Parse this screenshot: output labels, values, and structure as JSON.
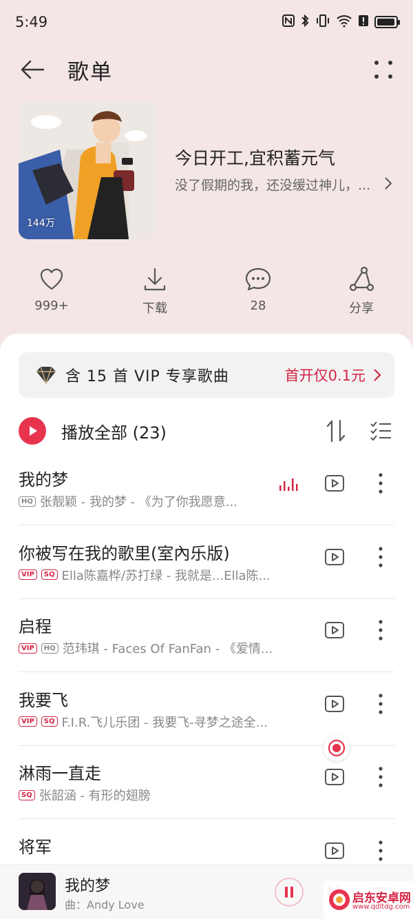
{
  "status_bar": {
    "time": "5:49"
  },
  "header": {
    "title": "歌单"
  },
  "playlist": {
    "cover_play_count": "144万",
    "title": "今日开工,宜积蓄元气",
    "description": "没了假期的我，还没缓过神儿，..."
  },
  "actions": [
    {
      "icon": "heart-icon",
      "label": "999+"
    },
    {
      "icon": "download-icon",
      "label": "下载"
    },
    {
      "icon": "comment-icon",
      "label": "28"
    },
    {
      "icon": "share-icon",
      "label": "分享"
    }
  ],
  "vip_banner": {
    "text": "含 15 首 VIP 专享歌曲",
    "offer": "首开仅0.1元"
  },
  "play_all": {
    "label": "播放全部 (23)"
  },
  "songs": [
    {
      "title": "我的梦",
      "badges": [
        "HQ"
      ],
      "artist": "张靓颖 - 我的梦 - 《为了你我愿意...",
      "playing": true
    },
    {
      "title": "你被写在我的歌里(室內乐版)",
      "badges": [
        "VIP",
        "SQ"
      ],
      "artist": "Ella陈嘉桦/苏打绿 - 我就是...Ella陈...",
      "playing": false
    },
    {
      "title": "启程",
      "badges": [
        "VIP",
        "HQ"
      ],
      "artist": "范玮琪 - Faces Of FanFan - 《爱情...",
      "playing": false
    },
    {
      "title": "我要飞",
      "badges": [
        "VIP",
        "SQ"
      ],
      "artist": "F.I.R.飞儿乐团 - 我要飞-寻梦之途全...",
      "playing": false
    },
    {
      "title": "淋雨一直走",
      "badges": [
        "SQ"
      ],
      "artist": "张韶涵 - 有形的翅膀",
      "playing": false
    },
    {
      "title": "将军",
      "badges": [],
      "artist": "",
      "playing": false
    }
  ],
  "now_playing": {
    "title": "我的梦",
    "artist": "曲：Andy Love"
  },
  "watermark": {
    "name": "启东安卓网",
    "url": "www.qdltdg.com"
  },
  "colors": {
    "accent": "#e8334f",
    "background": "#f4e6e6"
  }
}
